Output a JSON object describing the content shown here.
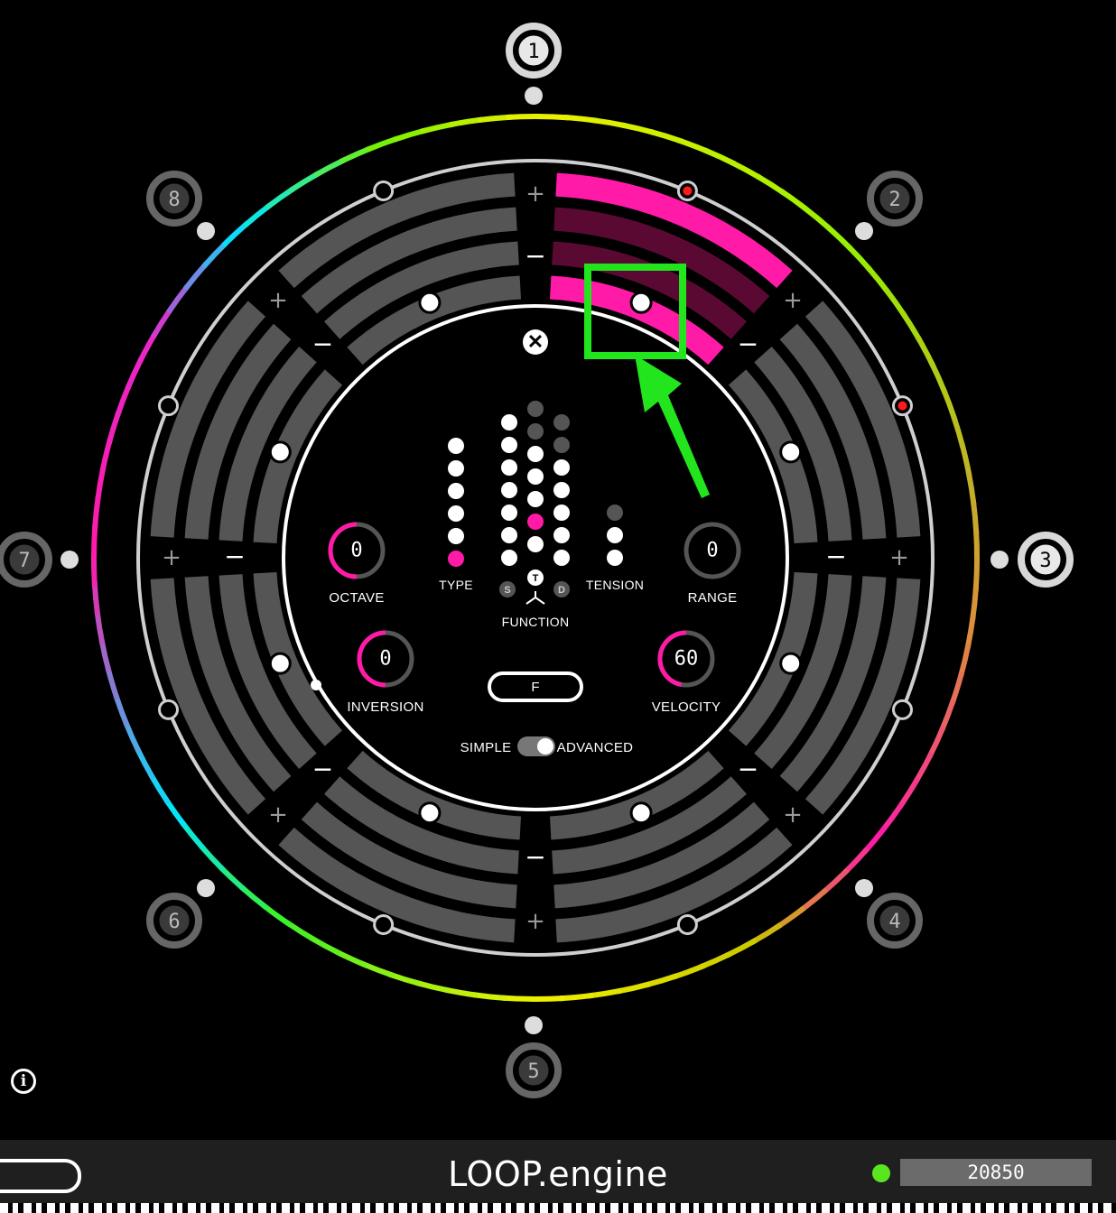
{
  "app": {
    "title": "LOOP.engine",
    "counter": "20850"
  },
  "colors": {
    "accent": "#ff1aa8",
    "active_dark": "#5a0a32",
    "status_green": "#59e61f",
    "ring_gray": "#555555"
  },
  "steps": [
    "1",
    "2",
    "3",
    "4",
    "5",
    "6",
    "7",
    "8"
  ],
  "ring_controls": {
    "plus": "+",
    "minus": "−"
  },
  "controls": {
    "octave": {
      "label": "OCTAVE",
      "value": "0",
      "level": 0.5
    },
    "range": {
      "label": "RANGE",
      "value": "0",
      "level": 0.0
    },
    "inversion": {
      "label": "INVERSION",
      "value": "0",
      "level": 0.5
    },
    "velocity": {
      "label": "VELOCITY",
      "value": "60",
      "level": 0.47
    },
    "type": {
      "label": "TYPE"
    },
    "function": {
      "label": "FUNCTION",
      "modes": [
        "S",
        "T",
        "D"
      ],
      "selected": "T"
    },
    "tension": {
      "label": "TENSION"
    },
    "f_button": "F",
    "close": "✕"
  },
  "mode_toggle": {
    "simple": "SIMPLE",
    "advanced": "ADVANCED",
    "state": "ADVANCED"
  },
  "info_icon": "i",
  "annotation": {
    "box_color": "#22e51e",
    "arrow_color": "#22e51e"
  }
}
